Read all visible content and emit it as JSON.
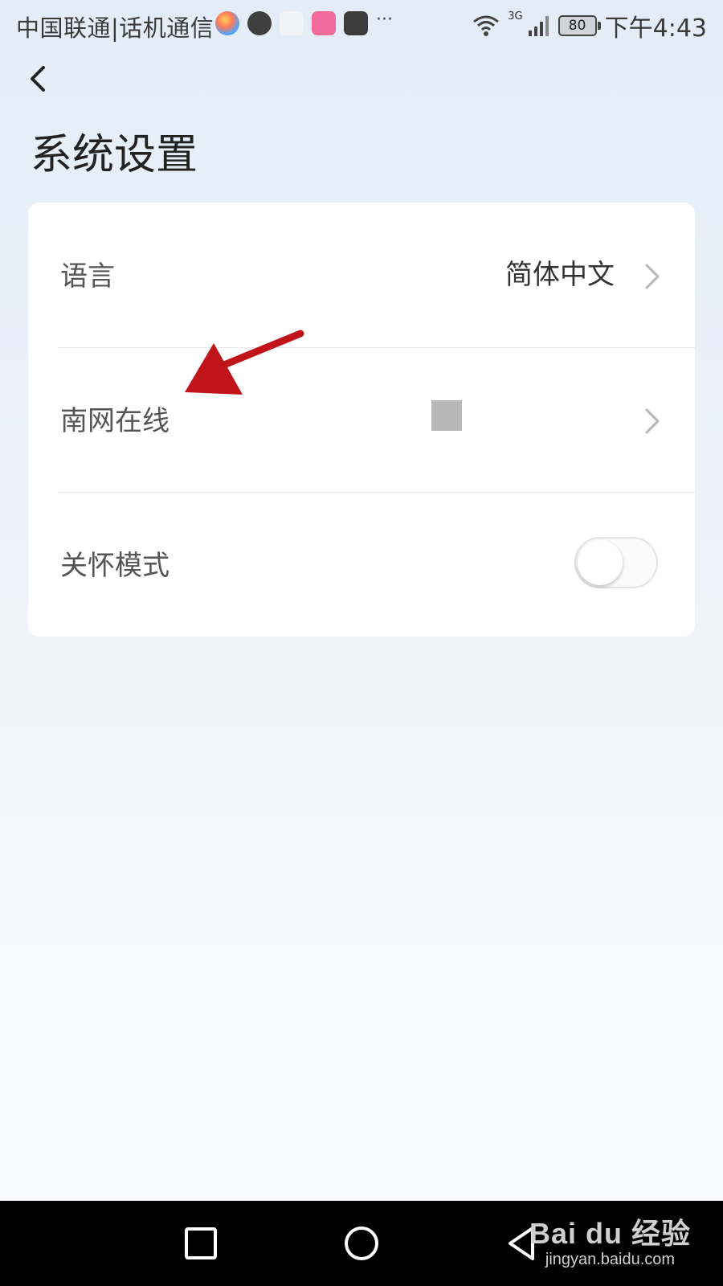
{
  "status_bar": {
    "carrier": "中国联通|话机通信",
    "network": "3G",
    "battery": "80",
    "time": "下午4:43"
  },
  "header": {
    "title": "系统设置"
  },
  "settings": {
    "language": {
      "label": "语言",
      "value": "简体中文"
    },
    "nanwang": {
      "label": "南网在线"
    },
    "care_mode": {
      "label": "关怀模式",
      "enabled": false
    }
  },
  "watermark": {
    "brand": "Bai du 经验",
    "url": "jingyan.baidu.com"
  },
  "colors": {
    "annotation_arrow": "#c0141a",
    "background_top": "#e4edf7",
    "card": "#ffffff"
  }
}
